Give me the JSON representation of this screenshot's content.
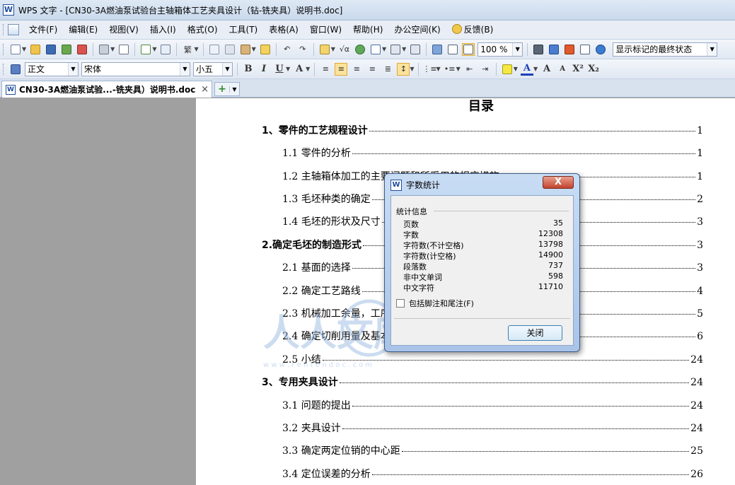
{
  "window": {
    "title": "WPS 文字 - [CN30-3A燃油泵试验台主轴箱体工艺夹具设计（钻-铣夹具）说明书.doc]",
    "app_icon_text": "W"
  },
  "menu": {
    "items": [
      "文件(F)",
      "编辑(E)",
      "视图(V)",
      "插入(I)",
      "格式(O)",
      "工具(T)",
      "表格(A)",
      "窗口(W)",
      "帮助(H)",
      "办公空间(K)",
      "反馈(B)"
    ]
  },
  "toolbar": {
    "zoom": "100 %",
    "track_changes": "显示标记的最终状态"
  },
  "format_bar": {
    "style": "正文",
    "font": "宋体",
    "size": "小五",
    "bold": "B",
    "italic": "I",
    "underline": "U",
    "traditional": "繁",
    "superscript": "X²",
    "subscript": "X₂",
    "char_a": "A"
  },
  "tabs": {
    "doc_tab_label": "CN30-3A燃油泵试验...-铣夹具）说明书.doc",
    "close_glyph": "×",
    "new_glyph": "+"
  },
  "document": {
    "toc_title": "目录",
    "toc": [
      {
        "text": "1、零件的工艺规程设计",
        "page": "1",
        "level": 1
      },
      {
        "text": "1.1 零件的分析",
        "page": "1",
        "level": 2
      },
      {
        "text": "1.2  主轴箱体加工的主要问题和所采用的相应措施",
        "page": "1",
        "level": 2
      },
      {
        "text": "1.3 毛坯种类的确定",
        "page": "2",
        "level": 2
      },
      {
        "text": "1.4 毛坯的形状及尺寸",
        "page": "3",
        "level": 2
      },
      {
        "text": "2.确定毛坯的制造形式",
        "page": "3",
        "level": 1
      },
      {
        "text": "2.1 基面的选择",
        "page": "3",
        "level": 2
      },
      {
        "text": "2.2 确定工艺路线",
        "page": "4",
        "level": 2
      },
      {
        "text": "2.3 机械加工余量，工序尺寸及毛坯尺寸的确定",
        "page": "5",
        "level": 2
      },
      {
        "text": "2.4   确定切削用量及基本工时",
        "page": "6",
        "level": 2
      },
      {
        "text": "2.5  小结",
        "page": "24",
        "level": 2
      },
      {
        "text": "3、专用夹具设计",
        "page": "24",
        "level": 1
      },
      {
        "text": "3.1  问题的提出",
        "page": "24",
        "level": 2
      },
      {
        "text": "3.2  夹具设计",
        "page": "24",
        "level": 2
      },
      {
        "text": "3.3  确定两定位销的中心距",
        "page": "25",
        "level": 2
      },
      {
        "text": "3.4 定位误差的分析",
        "page": "26",
        "level": 2
      }
    ]
  },
  "dialog": {
    "title": "字数统计",
    "close_glyph": "X",
    "group_label": "统计信息",
    "stats": [
      {
        "label": "页数",
        "value": "35"
      },
      {
        "label": "字数",
        "value": "12308"
      },
      {
        "label": "字符数(不计空格)",
        "value": "13798"
      },
      {
        "label": "字符数(计空格)",
        "value": "14900"
      },
      {
        "label": "段落数",
        "value": "737"
      },
      {
        "label": "非中文单词",
        "value": "598"
      },
      {
        "label": "中文字符",
        "value": "11710"
      }
    ],
    "checkbox_label": "包括脚注和尾注(F)",
    "close_button": "关闭"
  },
  "watermark": {
    "text": "人人文库",
    "url": "w w w . r e n r e n d o c . c o m"
  },
  "colors": {
    "title_bar": "#dfe9f5",
    "dialog_frame": "#a9c4e8",
    "close_red": "#c2432c"
  }
}
